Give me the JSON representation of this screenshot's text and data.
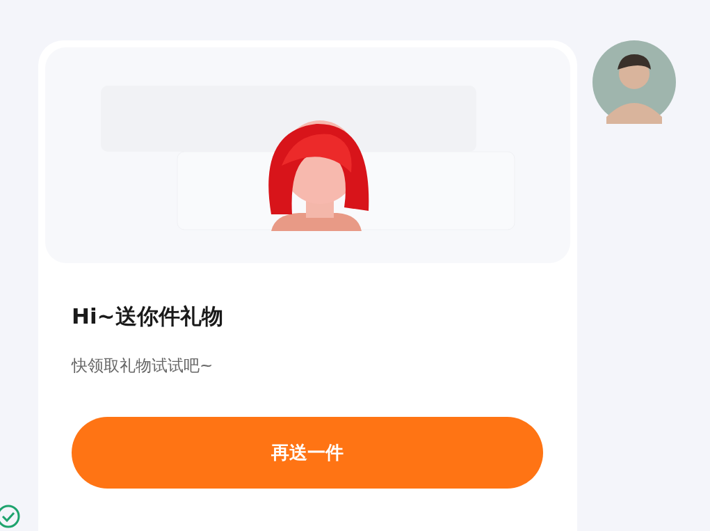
{
  "message": {
    "card": {
      "title": "Hi~送你件礼物",
      "subtitle": "快领取礼物试试吧~",
      "button": "再送一件"
    },
    "sent": true
  }
}
